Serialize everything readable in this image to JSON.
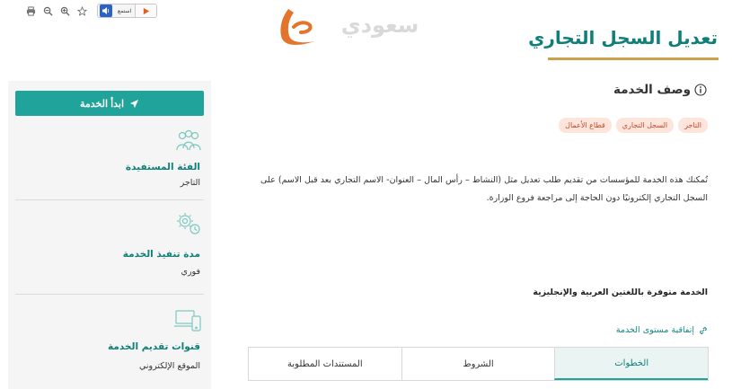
{
  "toolbar": {
    "icons": [
      "print-icon",
      "zoom-out-icon",
      "zoom-in-icon",
      "star-icon"
    ],
    "listen_label": "استمع"
  },
  "logo": {
    "text": "سعودي"
  },
  "page": {
    "title": "تعديل السجل التجاري"
  },
  "sidebar": {
    "start_label": "ابدأ الخدمة",
    "items": [
      {
        "icon": "people-icon",
        "heading": "الفئة المستفيدة",
        "value": "التاجر"
      },
      {
        "icon": "gears-clock-icon",
        "heading": "مدة تنفيذ الخدمة",
        "value": "فوري"
      },
      {
        "icon": "devices-icon",
        "heading": "قنوات تقديم الخدمة",
        "value": "الموقع الإلكتروني"
      }
    ]
  },
  "main": {
    "section_title": "وصف الخدمة",
    "tags": [
      "التاجر",
      "السجل التجاري",
      "قطاع الأعمال"
    ],
    "description": "تُمكنك هذه الخدمة للمؤسسات  من تقديم طلب تعديل مثل (النشاط – رأس المال – العنوان- الاسم التجاري بعد قبل الاسم)  على السجل التجاري إلكترونيًا دون الحاجة إلى مراجعة فروع الوزارة.",
    "language_note": "الخدمة متوفرة باللغتين العربية والإنجليزية",
    "sla_link": "إتفاقية مستوى الخدمة",
    "tabs": [
      "الخطوات",
      "الشروط",
      "المستندات المطلوبة"
    ]
  },
  "colors": {
    "primary": "#1fa39a",
    "title": "#0f7f7a",
    "accent": "#c9a24a",
    "tag_bg": "#fde5dc",
    "tag_text": "#c24a2a"
  }
}
